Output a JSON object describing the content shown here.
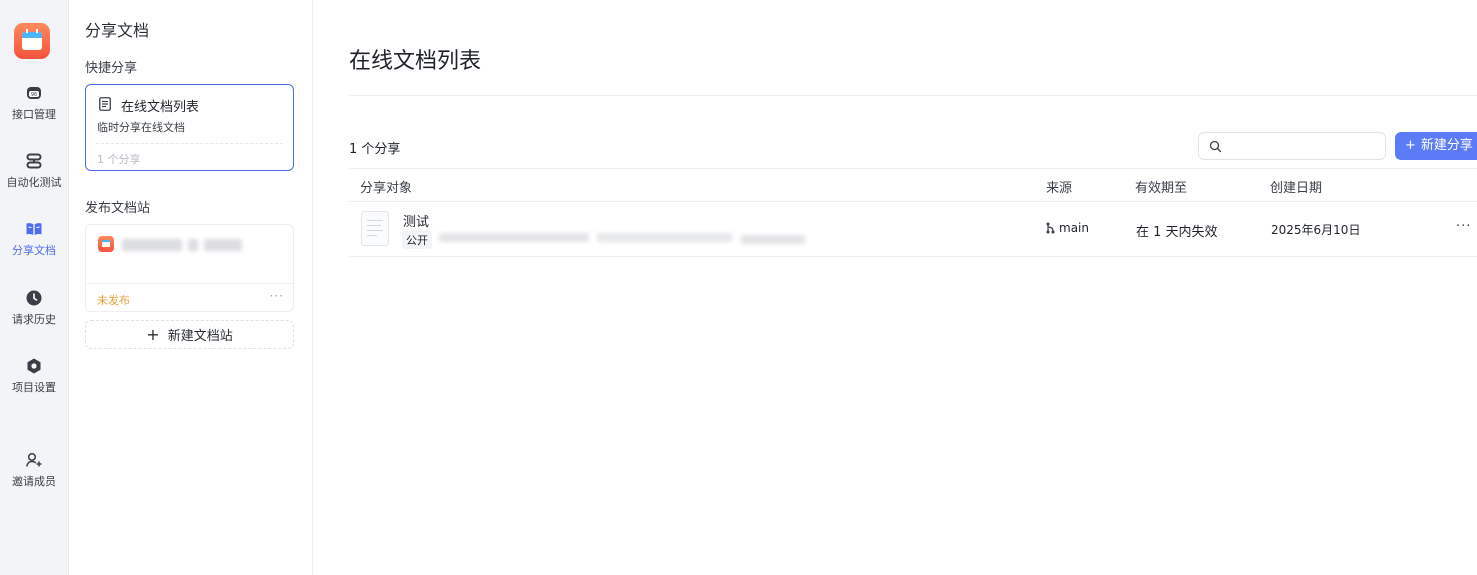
{
  "rail": {
    "items": [
      {
        "label": "接口管理",
        "icon": "api-icon"
      },
      {
        "label": "自动化测试",
        "icon": "automation-icon"
      },
      {
        "label": "分享文档",
        "icon": "book-icon"
      },
      {
        "label": "请求历史",
        "icon": "clock-icon"
      },
      {
        "label": "项目设置",
        "icon": "settings-icon"
      },
      {
        "label": "邀请成员",
        "icon": "user-plus-icon"
      }
    ],
    "active_index": 2,
    "active_color": "#4f6bf0"
  },
  "sidebar": {
    "title": "分享文档",
    "quick_share": {
      "label": "快捷分享",
      "card": {
        "title": "在线文档列表",
        "desc": "临时分享在线文档",
        "count": "1 个分享"
      }
    },
    "publish": {
      "label": "发布文档站",
      "card": {
        "status": "未发布",
        "more": "···"
      },
      "new_button": "新建文档站"
    }
  },
  "main": {
    "title": "在线文档列表",
    "count": "1 个分享",
    "search": {
      "placeholder": ""
    },
    "new_button": "新建分享",
    "table": {
      "headers": [
        "分享对象",
        "来源",
        "有效期至",
        "创建日期"
      ],
      "rows": [
        {
          "name": "测试",
          "visibility": "公开",
          "source": "main",
          "expires": "在 1 天内失效",
          "created": "2025年6月10日",
          "more": "···"
        }
      ]
    }
  },
  "colors": {
    "primary": "#5b7cf6",
    "accent": "#4f6bf0",
    "warning": "#e8a33a"
  }
}
